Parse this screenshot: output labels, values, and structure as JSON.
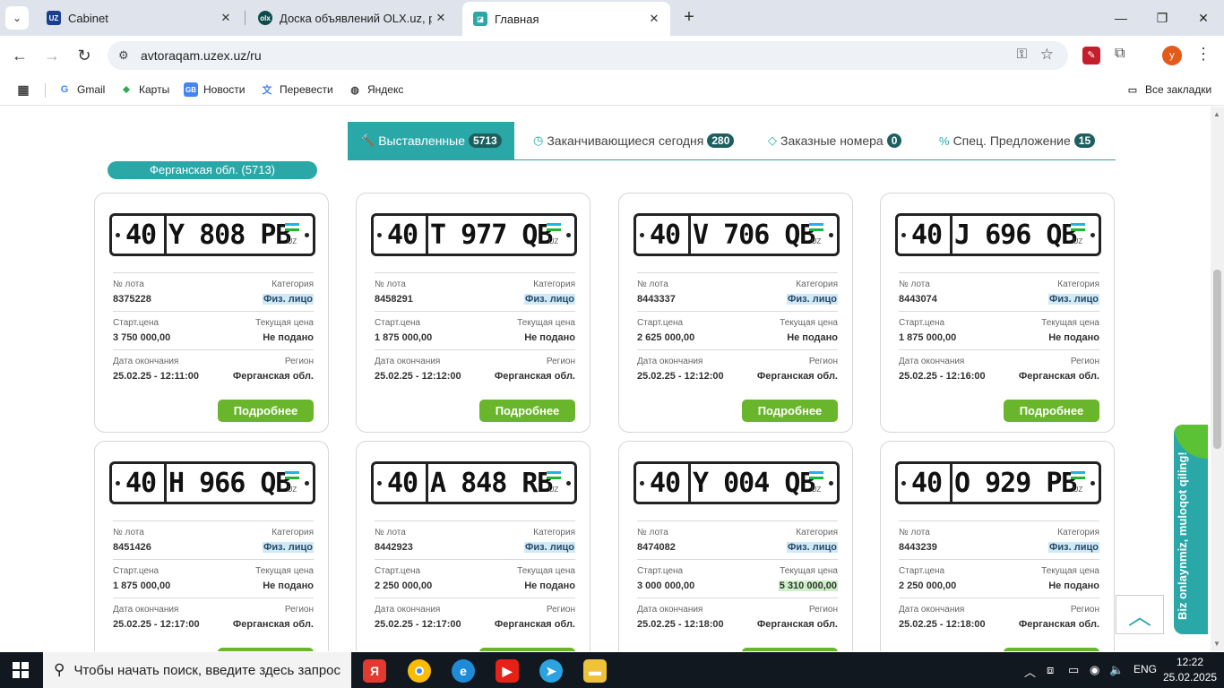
{
  "browser": {
    "tabs": [
      {
        "title": "Cabinet",
        "favicon": "uzex-icon"
      },
      {
        "title": "Доска объявлений OLX.uz, раз",
        "favicon": "olx-icon"
      },
      {
        "title": "Главная",
        "favicon": "avtoraqam-icon"
      }
    ],
    "url": "avtoraqam.uzex.uz/ru",
    "profile_initial": "y",
    "bookmarks": [
      "Gmail",
      "Карты",
      "Новости",
      "Перевести",
      "Яндекс"
    ],
    "all_bookmarks": "Все закладки"
  },
  "page": {
    "tabs": [
      {
        "label": "Выставленные",
        "count": "5713",
        "icon": "gavel-icon"
      },
      {
        "label": "Заканчивающиеся сегодня",
        "count": "280",
        "icon": "clock-icon"
      },
      {
        "label": "Заказные номера",
        "count": "0",
        "icon": "diamond-icon"
      },
      {
        "label": "Спец. Предложение",
        "count": "15",
        "icon": "percent-icon"
      }
    ],
    "region_filter": "Ферганская обл. (5713)",
    "labels": {
      "lot": "№ лота",
      "category": "Категория",
      "start_price": "Старт.цена",
      "current_price": "Текущая цена",
      "end_date": "Дата окончания",
      "region": "Регион",
      "more": "Подробнее"
    },
    "plate_country": "UZ",
    "cards": [
      {
        "region_code": "40",
        "number": "Y 808 PB",
        "lot": "8375228",
        "category": "Физ. лицо",
        "start_price": "3 750 000,00",
        "current_price": "Не подано",
        "end_date": "25.02.25 - 12:11:00",
        "region": "Ферганская обл."
      },
      {
        "region_code": "40",
        "number": "T 977 QB",
        "lot": "8458291",
        "category": "Физ. лицо",
        "start_price": "1 875 000,00",
        "current_price": "Не подано",
        "end_date": "25.02.25 - 12:12:00",
        "region": "Ферганская обл."
      },
      {
        "region_code": "40",
        "number": "V 706 QB",
        "lot": "8443337",
        "category": "Физ. лицо",
        "start_price": "2 625 000,00",
        "current_price": "Не подано",
        "end_date": "25.02.25 - 12:12:00",
        "region": "Ферганская обл."
      },
      {
        "region_code": "40",
        "number": "J 696 QB",
        "lot": "8443074",
        "category": "Физ. лицо",
        "start_price": "1 875 000,00",
        "current_price": "Не подано",
        "end_date": "25.02.25 - 12:16:00",
        "region": "Ферганская обл."
      },
      {
        "region_code": "40",
        "number": "H 966 QB",
        "lot": "8451426",
        "category": "Физ. лицо",
        "start_price": "1 875 000,00",
        "current_price": "Не подано",
        "end_date": "25.02.25 - 12:17:00",
        "region": "Ферганская обл."
      },
      {
        "region_code": "40",
        "number": "A 848 RB",
        "lot": "8442923",
        "category": "Физ. лицо",
        "start_price": "2 250 000,00",
        "current_price": "Не подано",
        "end_date": "25.02.25 - 12:17:00",
        "region": "Ферганская обл."
      },
      {
        "region_code": "40",
        "number": "Y 004 QB",
        "lot": "8474082",
        "category": "Физ. лицо",
        "start_price": "3 000 000,00",
        "current_price": "5 310 000,00",
        "end_date": "25.02.25 - 12:18:00",
        "region": "Ферганская обл."
      },
      {
        "region_code": "40",
        "number": "O 929 PB",
        "lot": "8443239",
        "category": "Физ. лицо",
        "start_price": "2 250 000,00",
        "current_price": "Не подано",
        "end_date": "25.02.25 - 12:18:00",
        "region": "Ферганская обл."
      }
    ],
    "side_widget": "Biz onlaynmiz, muloqot qiling!"
  },
  "taskbar": {
    "search_placeholder": "Чтобы начать поиск, введите здесь запрос",
    "lang": "ENG",
    "time": "12:22",
    "date": "25.02.2025"
  },
  "colors": {
    "accent_teal": "#2aa8a8",
    "button_green": "#69b52b",
    "badge_dark": "#1d5f5f"
  }
}
